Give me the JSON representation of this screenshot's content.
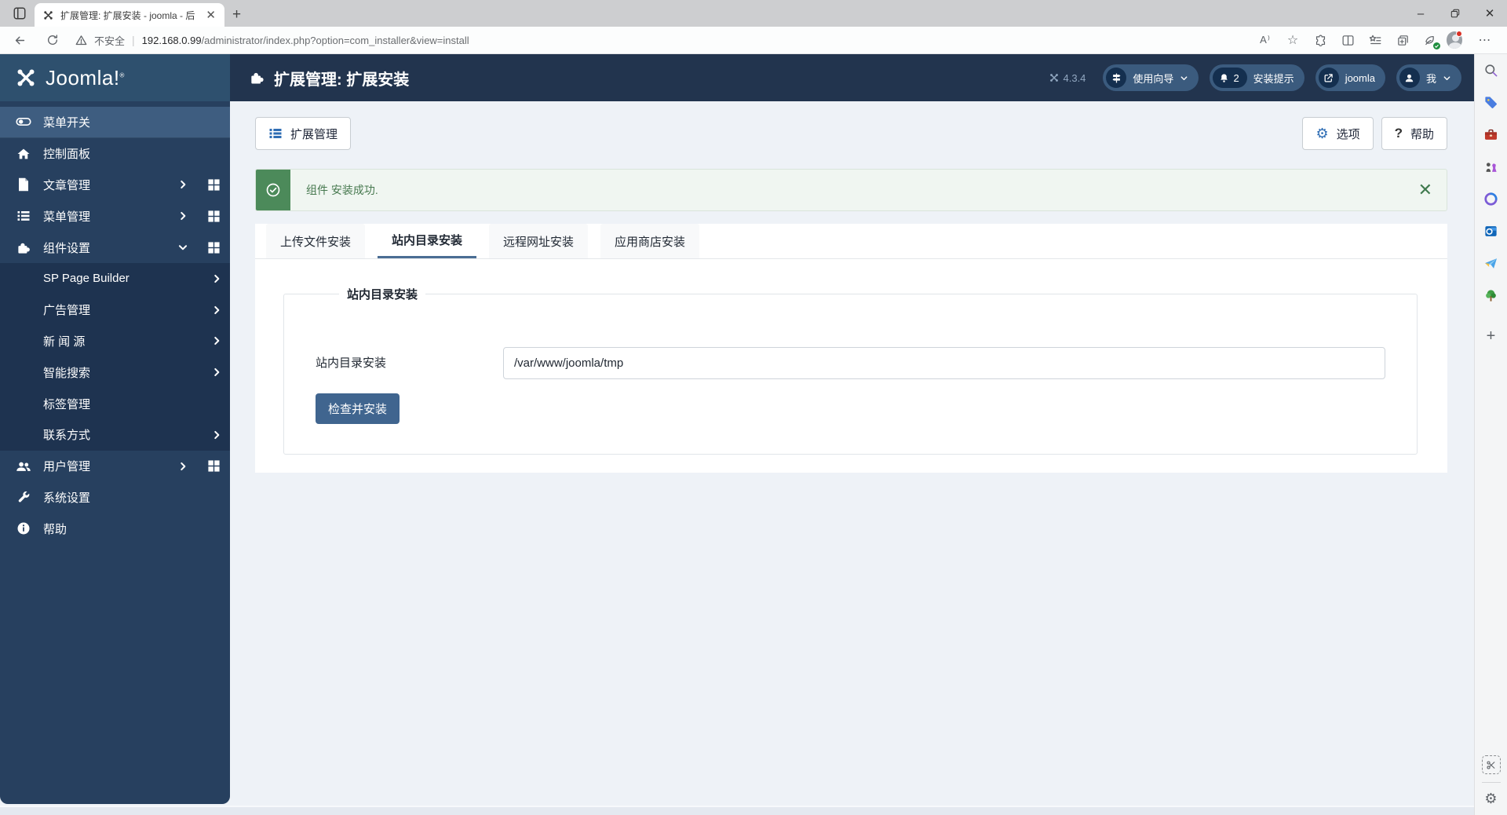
{
  "browser": {
    "tab_title": "扩展管理: 扩展安装 - joomla - 后",
    "security_label": "不安全",
    "url_host": "192.168.0.99",
    "url_path": "/administrator/index.php?option=com_installer&view=install",
    "read_aloud_label": "A⁾",
    "toolbar_icons": [
      "back-icon",
      "refresh-icon",
      "warning-icon",
      "favorite-star-icon",
      "extensions-puzzle-icon",
      "split-screen-icon",
      "favorites-list-icon",
      "collections-add-icon",
      "browser-essentials-icon",
      "profile-avatar",
      "more-menu-icon"
    ]
  },
  "edge_rail": {
    "icons": [
      "search-icon",
      "shopping-tag-icon",
      "toolbox-icon",
      "games-icon",
      "microsoft365-icon",
      "outlook-icon",
      "drop-icon",
      "tree-icon",
      "add-icon",
      "screenshot-icon",
      "settings-gear-icon"
    ]
  },
  "joomla": {
    "brand": "Joomla!",
    "brand_reg": "®",
    "page_title": "扩展管理: 扩展安装",
    "version": "4.3.4",
    "pills": {
      "tour_label": "使用向导",
      "notify_count": "2",
      "notify_label": "安装提示",
      "site_label": "joomla",
      "user_label": "我"
    },
    "sidebar": {
      "items": [
        {
          "label": "菜单开关"
        },
        {
          "label": "控制面板"
        },
        {
          "label": "文章管理"
        },
        {
          "label": "菜单管理"
        },
        {
          "label": "组件设置"
        },
        {
          "label": "用户管理"
        },
        {
          "label": "系统设置"
        },
        {
          "label": "帮助"
        }
      ],
      "submenu": [
        {
          "label": "SP Page Builder"
        },
        {
          "label": "广告管理"
        },
        {
          "label": "新 闻 源"
        },
        {
          "label": "智能搜索"
        },
        {
          "label": "标签管理"
        },
        {
          "label": "联系方式"
        }
      ]
    },
    "toolbar": {
      "extensions_button": "扩展管理",
      "options_button": "选项",
      "help_button": "帮助"
    },
    "alert": {
      "message": "组件 安装成功."
    },
    "tabs": [
      {
        "label": "上传文件安装"
      },
      {
        "label": "站内目录安装"
      },
      {
        "label": "远程网址安装"
      },
      {
        "label": "应用商店安装"
      }
    ],
    "form": {
      "legend": "站内目录安装",
      "field_label": "站内目录安装",
      "field_value": "/var/www/joomla/tmp",
      "submit_button": "检查并安装"
    },
    "colors": {
      "header": "#22344e",
      "logo_block": "#2e506e",
      "sidebar": "#27405f",
      "submenu": "#1e3350",
      "active_item": "#3e5d80",
      "accent_blue": "#2e6db4",
      "tab_underline": "#4a6d94",
      "primary_button": "#40658f",
      "success_green": "#4c8a5a",
      "page_bg": "#eef2f7"
    }
  }
}
